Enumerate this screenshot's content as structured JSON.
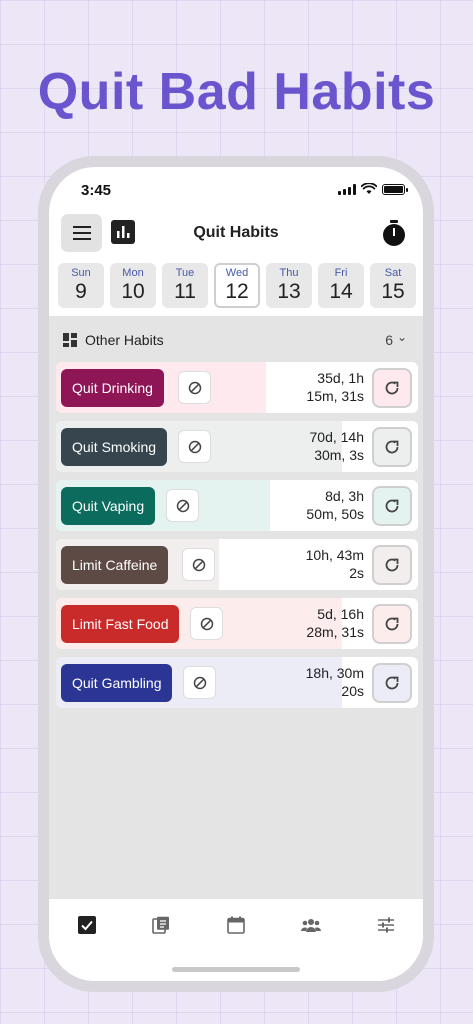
{
  "headline": "Quit Bad Habits",
  "status": {
    "time": "3:45"
  },
  "header": {
    "title": "Quit Habits"
  },
  "week": [
    {
      "name": "Sun",
      "num": "9",
      "active": false
    },
    {
      "name": "Mon",
      "num": "10",
      "active": false
    },
    {
      "name": "Tue",
      "num": "11",
      "active": false
    },
    {
      "name": "Wed",
      "num": "12",
      "active": true
    },
    {
      "name": "Thu",
      "num": "13",
      "active": false
    },
    {
      "name": "Fri",
      "num": "14",
      "active": false
    },
    {
      "name": "Sat",
      "num": "15",
      "active": false
    }
  ],
  "section": {
    "title": "Other Habits",
    "count": "6"
  },
  "habits": [
    {
      "name": "Quit Drinking",
      "time": "35d, 1h\n15m, 31s",
      "color": "#8e1556",
      "tint": "#fde9ee",
      "progress": 0.58
    },
    {
      "name": "Quit Smoking",
      "time": "70d, 14h\n30m, 3s",
      "color": "#37464e",
      "tint": "#edefef",
      "progress": 0.79
    },
    {
      "name": "Quit Vaping",
      "time": "8d, 3h\n50m, 50s",
      "color": "#0b6c5e",
      "tint": "#e4f2f0",
      "progress": 0.59
    },
    {
      "name": "Limit Caffeine",
      "time": "10h, 43m\n2s",
      "color": "#5d4a44",
      "tint": "#f1eeed",
      "progress": 0.45
    },
    {
      "name": "Limit Fast Food",
      "time": "5d, 16h\n28m, 31s",
      "color": "#c92a2a",
      "tint": "#fdecec",
      "progress": 0.79
    },
    {
      "name": "Quit Gambling",
      "time": "18h, 30m\n20s",
      "color": "#2a3594",
      "tint": "#ebecf6",
      "progress": 0.79
    }
  ],
  "nav": [
    {
      "icon": "checkbox-icon",
      "active": true
    },
    {
      "icon": "journal-icon",
      "active": false
    },
    {
      "icon": "calendar-icon",
      "active": false
    },
    {
      "icon": "group-icon",
      "active": false
    },
    {
      "icon": "sliders-icon",
      "active": false
    }
  ]
}
